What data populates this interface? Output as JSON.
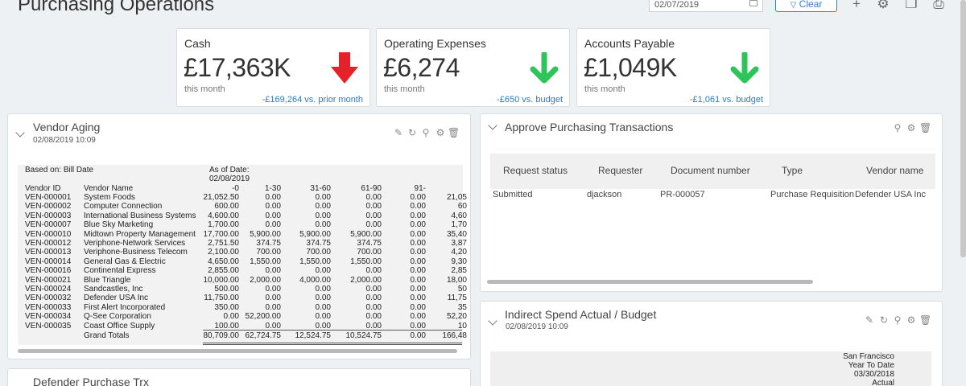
{
  "header": {
    "title": "Purchasing Operations",
    "date": "02/07/2019",
    "clear_label": "Clear"
  },
  "kpis": [
    {
      "label": "Cash",
      "value": "£17,363K",
      "sub": "this month",
      "compare": "-£169,264 vs. prior month",
      "color": "#e8202a"
    },
    {
      "label": "Operating Expenses",
      "value": "£6,274",
      "sub": "this month",
      "compare": "-£650 vs. budget",
      "color": "#2fc45a"
    },
    {
      "label": "Accounts Payable",
      "value": "£1,049K",
      "sub": "this month",
      "compare": "-£1,061 vs. budget",
      "color": "#2fc45a"
    }
  ],
  "vendor_aging": {
    "title": "Vendor Aging",
    "date": "02/08/2019 10:09",
    "based_on": "Based on: Bill Date",
    "as_of_label": "As of Date:",
    "as_of_date": "02/08/2019",
    "columns": [
      "Vendor ID",
      "Vendor Name",
      "-0",
      "1-30",
      "31-60",
      "61-90",
      "91-",
      ""
    ],
    "rows": [
      [
        "VEN-000001",
        "System Foods",
        "21,052.50",
        "0.00",
        "0.00",
        "0.00",
        "0.00",
        "21,05"
      ],
      [
        "VEN-000002",
        "Computer Connection",
        "600.00",
        "0.00",
        "0.00",
        "0.00",
        "0.00",
        "60"
      ],
      [
        "VEN-000003",
        "International Business Systems",
        "4,600.00",
        "0.00",
        "0.00",
        "0.00",
        "0.00",
        "4,60"
      ],
      [
        "VEN-000007",
        "Blue Sky Marketing",
        "1,700.00",
        "0.00",
        "0.00",
        "0.00",
        "0.00",
        "1,70"
      ],
      [
        "VEN-000010",
        "Midtown Property Management",
        "17,700.00",
        "5,900.00",
        "5,900.00",
        "5,900.00",
        "0.00",
        "35,40"
      ],
      [
        "VEN-000012",
        "Veriphone-Network Services",
        "2,751.50",
        "374.75",
        "374.75",
        "374.75",
        "0.00",
        "3,87"
      ],
      [
        "VEN-000013",
        "Veriphone-Business Telecom",
        "2,100.00",
        "700.00",
        "700.00",
        "700.00",
        "0.00",
        "4,20"
      ],
      [
        "VEN-000014",
        "General Gas & Electric",
        "4,650.00",
        "1,550.00",
        "1,550.00",
        "1,550.00",
        "0.00",
        "9,30"
      ],
      [
        "VEN-000016",
        "Continental Express",
        "2,855.00",
        "0.00",
        "0.00",
        "0.00",
        "0.00",
        "2,85"
      ],
      [
        "VEN-000021",
        "Blue Triangle",
        "10,000.00",
        "2,000.00",
        "4,000.00",
        "2,000.00",
        "0.00",
        "18,00"
      ],
      [
        "VEN-000024",
        "Sandcastles, Inc",
        "500.00",
        "0.00",
        "0.00",
        "0.00",
        "0.00",
        "50"
      ],
      [
        "VEN-000032",
        "Defender USA Inc",
        "11,750.00",
        "0.00",
        "0.00",
        "0.00",
        "0.00",
        "11,75"
      ],
      [
        "VEN-000033",
        "First Alert Incorporated",
        "350.00",
        "0.00",
        "0.00",
        "0.00",
        "0.00",
        "35"
      ],
      [
        "VEN-000034",
        "Q-See Corporation",
        "0.00",
        "52,200.00",
        "0.00",
        "0.00",
        "0.00",
        "52,20"
      ],
      [
        "VEN-000035",
        "Coast Office Supply",
        "100.00",
        "0.00",
        "0.00",
        "0.00",
        "0.00",
        "10"
      ]
    ],
    "totals_label": "Grand Totals",
    "totals": [
      "80,709.00",
      "62,724.75",
      "12,524.75",
      "10,524.75",
      "0.00",
      "166,48"
    ]
  },
  "approve": {
    "title": "Approve Purchasing Transactions",
    "columns": [
      "Request status",
      "Requester",
      "Document number",
      "Type",
      "Vendor name"
    ],
    "rows": [
      [
        "Submitted",
        "djackson",
        "PR-000057",
        "Purchase Requisition",
        "Defender USA Inc"
      ]
    ]
  },
  "indirect": {
    "title": "Indirect Spend Actual / Budget",
    "date": "02/08/2019 10:09",
    "lines": [
      "San Francisco",
      "Year To Date",
      "03/30/2018",
      "Actual"
    ]
  },
  "defender": {
    "title": "Defender Purchase Trx"
  }
}
